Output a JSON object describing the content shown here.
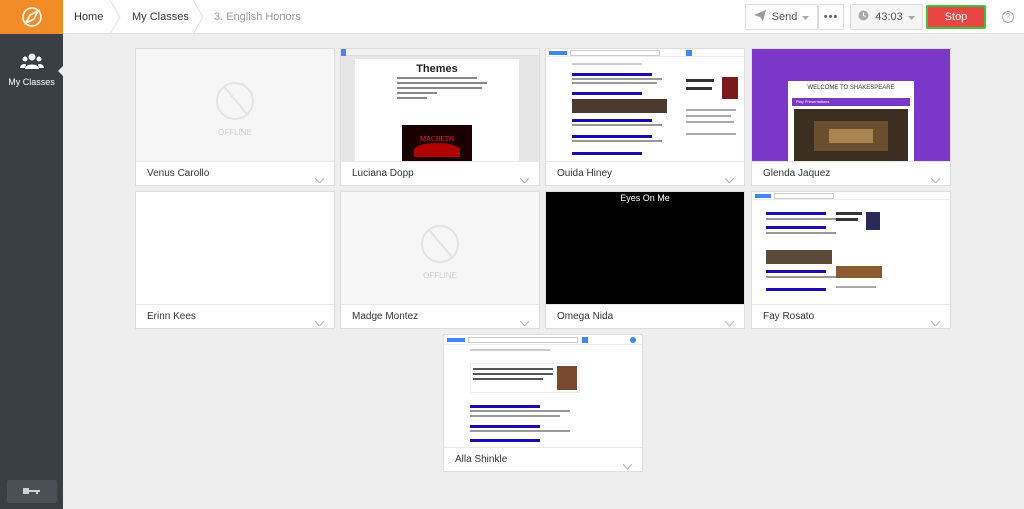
{
  "sidebar": {
    "logo_icon": "compass-logo-icon",
    "nav_label": "My Classes",
    "nav_icon": "users-icon",
    "signout_icon": "key-icon"
  },
  "breadcrumbs": {
    "home": "Home",
    "classes": "My Classes",
    "current": "3. English Honors"
  },
  "toolbar": {
    "send_label": "Send",
    "timer": "43:03",
    "stop_label": "Stop",
    "help": "?"
  },
  "students": [
    {
      "name": "Venus Carollo",
      "status": "offline",
      "status_label": "OFFLINE"
    },
    {
      "name": "Luciana Dopp",
      "status": "doc",
      "doc_heading": "Themes",
      "doc_image_text": "MACBETH"
    },
    {
      "name": "Ouida Hiney",
      "status": "search"
    },
    {
      "name": "Glenda Jaquez",
      "status": "slides",
      "slide_title": "WELCOME TO SHAKESPEARE",
      "slide_sub": "Play Presentations"
    },
    {
      "name": "Erinn Kees",
      "status": "blank"
    },
    {
      "name": "Madge Montez",
      "status": "offline",
      "status_label": "OFFLINE"
    },
    {
      "name": "Omega Nida",
      "status": "video",
      "video_title": "Eyes On Me"
    },
    {
      "name": "Fay Rosato",
      "status": "search"
    },
    {
      "name": "Alla Shinkle",
      "status": "search"
    }
  ],
  "colors": {
    "accent": "#f28c28",
    "sidebar": "#3a3f44",
    "stop": "#e84545",
    "stop_border": "#3cc43c"
  }
}
